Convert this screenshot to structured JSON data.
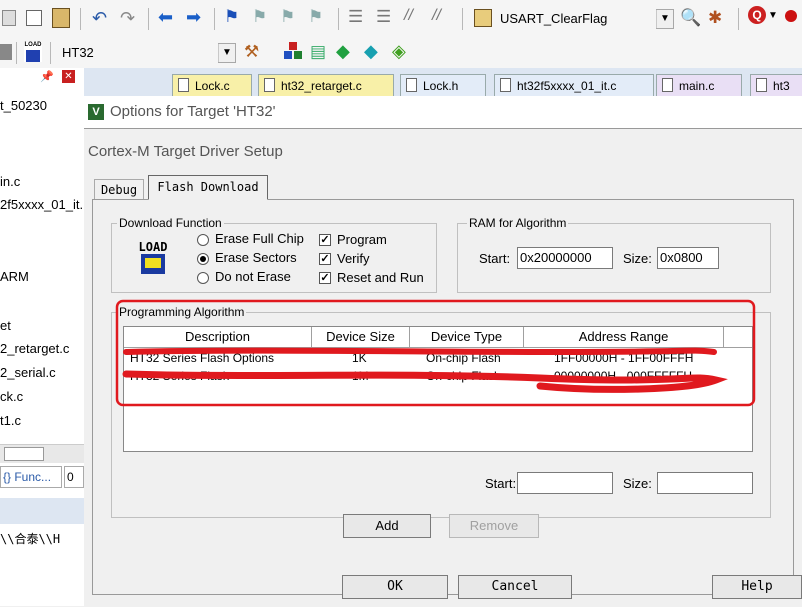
{
  "toolbar": {
    "target_function": "USART_ClearFlag",
    "target_combo": "HT32",
    "load_label": "LOAD"
  },
  "project_tree": {
    "items": [
      {
        "label": "t_50230"
      },
      {
        "label": "in.c"
      },
      {
        "label": "2f5xxxx_01_it."
      },
      {
        "label": "ARM"
      },
      {
        "label": "et"
      },
      {
        "label": "2_retarget.c"
      },
      {
        "label": "2_serial.c"
      },
      {
        "label": "ck.c"
      },
      {
        "label": "t1.c"
      }
    ],
    "functions_tab": "{} Func...",
    "second_tab": "0",
    "path_text": "\\\\合泰\\\\H"
  },
  "tabs": [
    {
      "label": "Lock.c",
      "active": true
    },
    {
      "label": "ht32_retarget.c"
    },
    {
      "label": "Lock.h"
    },
    {
      "label": "ht32f5xxxx_01_it.c"
    },
    {
      "label": "main.c"
    },
    {
      "label": "ht3"
    }
  ],
  "dialog": {
    "title": "Options for Target 'HT32'",
    "subtitle": "Cortex-M Target Driver Setup",
    "tabs": [
      "Debug",
      "Flash Download"
    ],
    "download_function": {
      "label": "Download Function",
      "load_icon_text": "LOAD",
      "radios": [
        {
          "label": "Erase Full Chip",
          "checked": false
        },
        {
          "label": "Erase Sectors",
          "checked": true
        },
        {
          "label": "Do not Erase",
          "checked": false
        }
      ],
      "checkboxes": [
        {
          "label": "Program",
          "checked": true
        },
        {
          "label": "Verify",
          "checked": true
        },
        {
          "label": "Reset and Run",
          "checked": true
        }
      ]
    },
    "ram": {
      "label": "RAM for Algorithm",
      "start_label": "Start:",
      "start_value": "0x20000000",
      "size_label": "Size:",
      "size_value": "0x0800"
    },
    "programming": {
      "label": "Programming Algorithm",
      "columns": [
        "Description",
        "Device Size",
        "Device Type",
        "Address Range"
      ],
      "rows": [
        {
          "description": "HT32 Series Flash Options",
          "size": "1K",
          "type": "On-chip Flash",
          "range": "1FF00000H - 1FF00FFFH"
        },
        {
          "description": "HT32 Series Flash",
          "size": "1M",
          "type": "On-chip Flash",
          "range": "00000000H - 000FFFFFH"
        }
      ],
      "start_label": "Start:",
      "start_value": "",
      "size_label": "Size:",
      "size_value": ""
    },
    "buttons": {
      "add": "Add",
      "remove": "Remove",
      "ok": "OK",
      "cancel": "Cancel",
      "help": "Help"
    },
    "annotation_color": "#e0191e"
  }
}
